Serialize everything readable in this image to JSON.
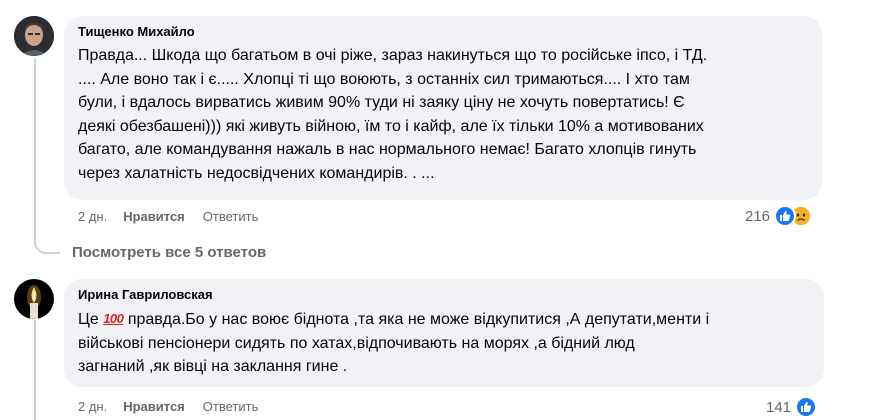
{
  "comments": [
    {
      "author": "Тищенко Михайло",
      "text": "Правда... Шкода що багатьом в очі ріже, зараз накинуться що то російське іпсо, і ТД.\n.... Але воно так і є..... Хлопці ті що воюють, з останніх сил тримаються.... І хто там\nбули, і вдалось вирватись живим 90% туди ні заяку ціну не хочуть повертатись! Є\nдеякі обезбашені))) які живуть війною, їм то і кайф, але їх тільки 10% а мотивованих\nбагато, але командування нажаль в нас нормального немає! Багато хлопців гинуть\nчерез халатність недосвідчених командирів. . ...",
      "time": "2 дн.",
      "like_label": "Нравится",
      "reply_label": "Ответить",
      "reaction_count": "216",
      "reactions": [
        "like-icon",
        "sad-icon"
      ]
    },
    {
      "author": "Ирина Гавриловская",
      "text_before_emoji": "Це ",
      "emoji": "100",
      "text_after_emoji": " правда.Бо у нас воює біднота ,та яка не може відкупитися ,А депутати,менти і\nвійськові пенсіонери сидять по хатах,відпочивають на морях ,а бідний люд\nзагнаний ,як вівці на заклання гине .",
      "time": "2 дн.",
      "like_label": "Нравится",
      "reply_label": "Ответить",
      "reaction_count": "141",
      "reactions": [
        "like-icon"
      ]
    }
  ],
  "view_replies": "Посмотреть все 5 ответов",
  "colors": {
    "bubble": "#f0f2f5",
    "meta": "#65676b",
    "like_blue": "#1877f2",
    "sad_yellow": "#f7b125"
  }
}
